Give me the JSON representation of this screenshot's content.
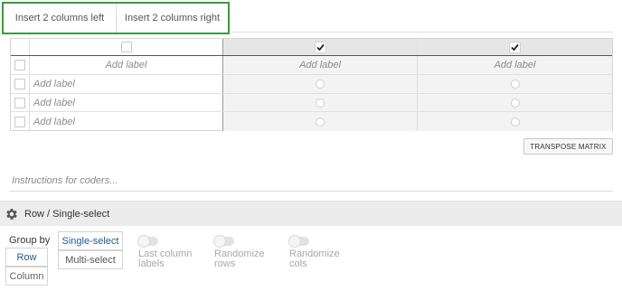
{
  "toolbar": {
    "insert_left_label": "Insert 2 columns left",
    "insert_right_label": "Insert 2 columns right"
  },
  "matrix": {
    "header": {
      "col0_checked": false,
      "col1_checked": true,
      "col2_checked": true
    },
    "column_labels": [
      "Add label",
      "Add label",
      "Add label"
    ],
    "rows": [
      {
        "label": "Add label"
      },
      {
        "label": "Add label"
      },
      {
        "label": "Add label"
      }
    ],
    "transpose_label": "TRANSPOSE MATRIX"
  },
  "instructions_placeholder": "Instructions for coders...",
  "settings": {
    "title": "Row / Single-select",
    "group_by_label": "Group by",
    "group_row": "Row",
    "group_column": "Column",
    "single_select": "Single-select",
    "multi_select": "Multi-select",
    "toggles": [
      {
        "line1": "Last column",
        "line2": "labels"
      },
      {
        "line1": "Randomize",
        "line2": "rows"
      },
      {
        "line1": "Randomize",
        "line2": "cols"
      }
    ]
  },
  "colors": {
    "accent_green": "#3c9a3c",
    "link_blue": "#1f5a8c"
  }
}
